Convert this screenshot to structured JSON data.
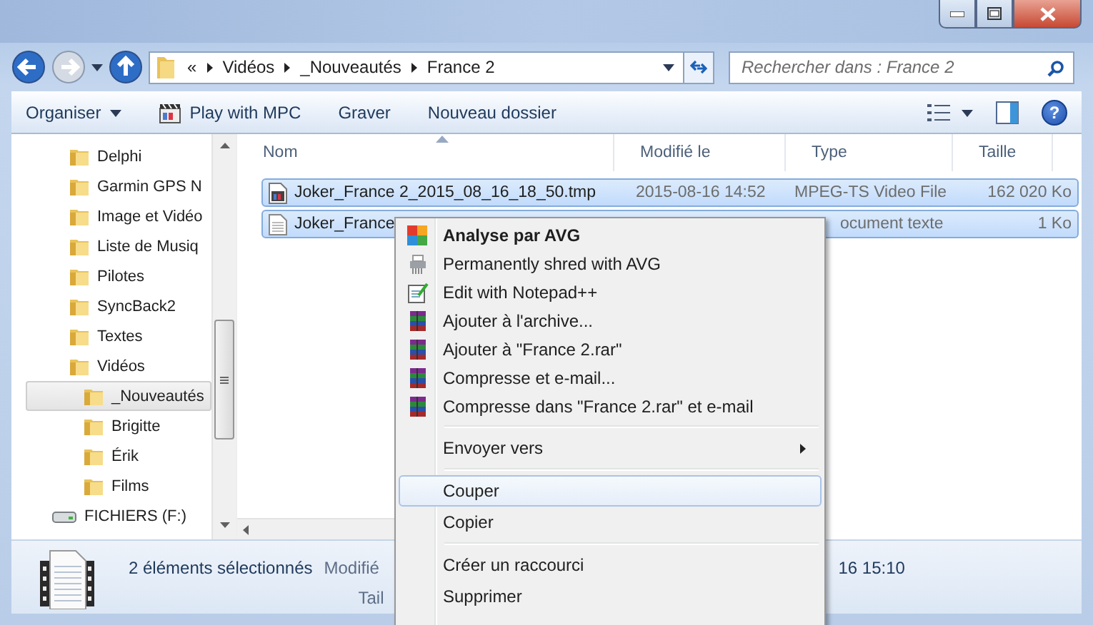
{
  "address": {
    "overflow": "«",
    "crumbs": [
      "Vidéos",
      "_Nouveautés",
      "France 2"
    ]
  },
  "search": {
    "placeholder": "Rechercher dans : France 2"
  },
  "toolbar": {
    "buttons": [
      {
        "label": "Organiser",
        "kind": "dropdown"
      },
      {
        "label": "Play with MPC",
        "kind": "mpc"
      },
      {
        "label": "Graver",
        "kind": "plain"
      },
      {
        "label": "Nouveau dossier",
        "kind": "plain"
      }
    ],
    "help": "?"
  },
  "sidebar": {
    "items": [
      {
        "label": "Delphi",
        "kind": "folder",
        "selected": false
      },
      {
        "label": "Garmin GPS N",
        "kind": "folder",
        "selected": false
      },
      {
        "label": "Image et Vidéo",
        "kind": "folder",
        "selected": false
      },
      {
        "label": "Liste de Musiq",
        "kind": "folder",
        "selected": false
      },
      {
        "label": "Pilotes",
        "kind": "folder",
        "selected": false
      },
      {
        "label": "SyncBack2",
        "kind": "folder",
        "selected": false
      },
      {
        "label": "Textes",
        "kind": "folder",
        "selected": false
      },
      {
        "label": "Vidéos",
        "kind": "folder",
        "selected": false,
        "children": [
          {
            "label": "_Nouveautés",
            "kind": "folder",
            "selected": true
          },
          {
            "label": "Brigitte",
            "kind": "folder",
            "selected": false
          },
          {
            "label": "Érik",
            "kind": "folder",
            "selected": false
          },
          {
            "label": "Films",
            "kind": "folder",
            "selected": false
          }
        ]
      },
      {
        "label": "FICHIERS (F:)",
        "kind": "drive",
        "selected": false
      }
    ]
  },
  "table": {
    "columns": [
      "Nom",
      "Modifié le",
      "Type",
      "Taille"
    ],
    "rows": [
      {
        "kind": "video",
        "selected": true,
        "cells": [
          "Joker_France 2_2015_08_16_18_50.tmp",
          "2015-08-16 14:52",
          "MPEG-TS Video File",
          "162 020 Ko"
        ]
      },
      {
        "kind": "text",
        "selected": true,
        "cells": [
          "Joker_France",
          "",
          "ocument texte",
          "1 Ko"
        ]
      }
    ]
  },
  "details": {
    "summary": "2 éléments sélectionnés",
    "labels": [
      "Modifié",
      "Tail"
    ],
    "value": "16 15:10"
  },
  "context_menu": {
    "items": [
      {
        "kind": "avg",
        "label": "Analyse par AVG",
        "default": true,
        "submenu": false,
        "selected": false
      },
      {
        "kind": "shred",
        "label": "Permanently shred with AVG",
        "default": false,
        "submenu": false,
        "selected": false
      },
      {
        "kind": "notepad",
        "label": "Edit with Notepad++",
        "default": false,
        "submenu": false,
        "selected": false
      },
      {
        "kind": "rar",
        "label": "Ajouter à l'archive...",
        "default": false,
        "submenu": false,
        "selected": false
      },
      {
        "kind": "rar",
        "label": "Ajouter à \"France 2.rar\"",
        "default": false,
        "submenu": false,
        "selected": false
      },
      {
        "kind": "rar",
        "label": "Compresse et e-mail...",
        "default": false,
        "submenu": false,
        "selected": false
      },
      {
        "kind": "rar",
        "label": "Compresse dans \"France 2.rar\" et e-mail",
        "default": false,
        "submenu": false,
        "selected": false
      },
      {
        "kind": "separator"
      },
      {
        "kind": "plain",
        "label": "Envoyer vers",
        "default": false,
        "submenu": true,
        "selected": false
      },
      {
        "kind": "separator"
      },
      {
        "kind": "plain",
        "label": "Couper",
        "default": false,
        "submenu": false,
        "selected": true
      },
      {
        "kind": "plain",
        "label": "Copier",
        "default": false,
        "submenu": false,
        "selected": false
      },
      {
        "kind": "separator"
      },
      {
        "kind": "plain",
        "label": "Créer un raccourci",
        "default": false,
        "submenu": false,
        "selected": false
      },
      {
        "kind": "plain",
        "label": "Supprimer",
        "default": false,
        "submenu": false,
        "selected": false
      }
    ]
  }
}
